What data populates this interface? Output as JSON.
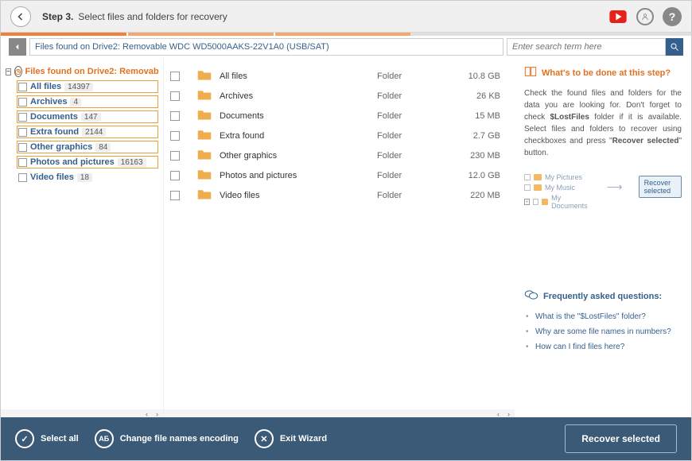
{
  "header": {
    "step": "Step 3.",
    "title": "Select files and folders for recovery"
  },
  "pathbar": {
    "path": "Files found on Drive2: Removable WDC WD5000AAKS-22V1A0 (USB/SAT)",
    "search_placeholder": "Enter search term here"
  },
  "tree": {
    "root": "Files found on Drive2: Removab",
    "items": [
      {
        "label": "All files",
        "count": "14397",
        "hl": true
      },
      {
        "label": "Archives",
        "count": "4",
        "hl": true
      },
      {
        "label": "Documents",
        "count": "147",
        "hl": true
      },
      {
        "label": "Extra found",
        "count": "2144",
        "hl": true
      },
      {
        "label": "Other graphics",
        "count": "84",
        "hl": true
      },
      {
        "label": "Photos and pictures",
        "count": "16163",
        "hl": true
      },
      {
        "label": "Video files",
        "count": "18",
        "hl": false
      }
    ]
  },
  "filelist": [
    {
      "name": "All files",
      "type": "Folder",
      "size": "10.8 GB"
    },
    {
      "name": "Archives",
      "type": "Folder",
      "size": "26 KB"
    },
    {
      "name": "Documents",
      "type": "Folder",
      "size": "15 MB"
    },
    {
      "name": "Extra found",
      "type": "Folder",
      "size": "2.7 GB"
    },
    {
      "name": "Other graphics",
      "type": "Folder",
      "size": "230 MB"
    },
    {
      "name": "Photos and pictures",
      "type": "Folder",
      "size": "12.0 GB"
    },
    {
      "name": "Video files",
      "type": "Folder",
      "size": "220 MB"
    }
  ],
  "sidebar": {
    "title": "What's to be done at this step?",
    "text_a": "Check the found files and folders for the data you are looking for. Don't forget to check ",
    "text_bold1": "$LostFiles",
    "text_b": " folder if it is available. Select files and folders to recover using checkboxes and press \"",
    "text_bold2": "Recover selected",
    "text_c": "\" button.",
    "illus": {
      "a": "My Pictures",
      "b": "My Music",
      "c": "My Documents",
      "btn": "Recover selected"
    },
    "faq_title": "Frequently asked questions:",
    "faq": [
      "What is the \"$LostFiles\" folder?",
      "Why are some file names in numbers?",
      "How can I find files here?"
    ]
  },
  "footer": {
    "select_all": "Select all",
    "encoding": "Change file names encoding",
    "exit": "Exit Wizard",
    "recover": "Recover selected"
  }
}
